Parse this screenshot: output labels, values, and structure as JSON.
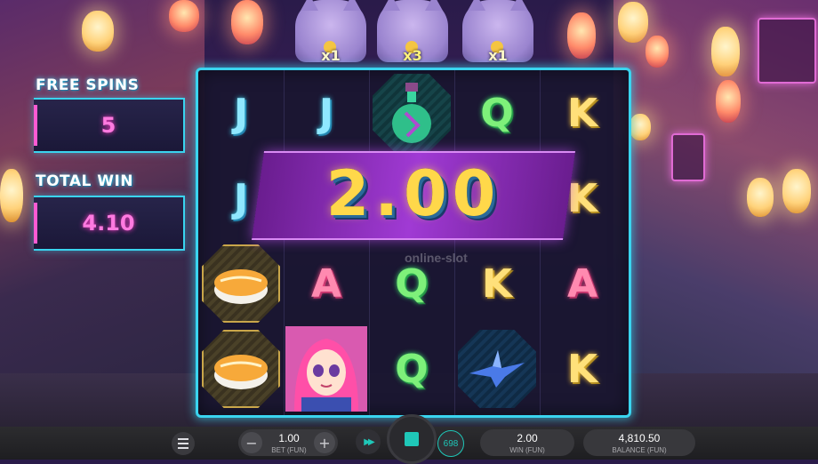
{
  "multipliers": [
    "x1",
    "x3",
    "x1"
  ],
  "free_spins": {
    "label": "FREE SPINS",
    "value": "5"
  },
  "total_win": {
    "label": "TOTAL WIN",
    "value": "4.10"
  },
  "win_banner": {
    "amount": "2.00"
  },
  "watermark": "online-slot",
  "reels": [
    [
      "J",
      "J",
      "sushi",
      "sushi"
    ],
    [
      "J",
      "",
      "A",
      "anime-girl"
    ],
    [
      "potion",
      "",
      "Q",
      "Q"
    ],
    [
      "Q",
      "",
      "K",
      "paper-crane"
    ],
    [
      "K",
      "K",
      "A",
      "K"
    ]
  ],
  "bottom_bar": {
    "bet_value": "1.00",
    "bet_caption": "BET (FUN)",
    "autoplay_count": "698",
    "win_value": "2.00",
    "win_caption": "WIN (FUN)",
    "balance_value": "4,810.50",
    "balance_caption": "BALANCE (FUN)",
    "minus_symbol": "−",
    "plus_symbol": "+",
    "fast_forward_symbol": "▶▶"
  },
  "colors": {
    "accent_cyan": "#3ad4ef",
    "accent_pink": "#ff7ae0",
    "win_gold": "#ffd84a",
    "spin_teal": "#1fc7b8"
  }
}
